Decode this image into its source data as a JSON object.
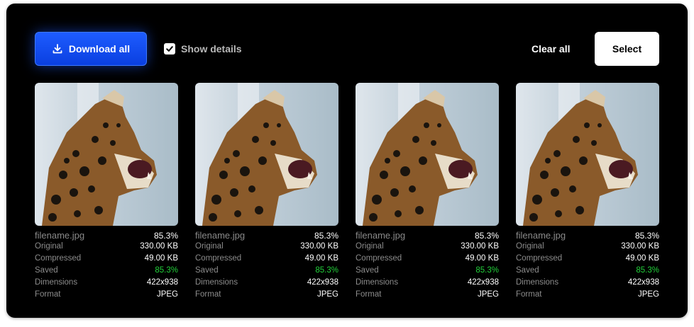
{
  "toolbar": {
    "download_label": "Download all",
    "show_details_label": "Show details",
    "show_details_checked": true,
    "clear_label": "Clear all",
    "select_label": "Select"
  },
  "labels": {
    "original": "Original",
    "compressed": "Compressed",
    "saved": "Saved",
    "dimensions": "Dimensions",
    "format": "Format"
  },
  "files": [
    {
      "filename": "filename.jpg",
      "percent": "85.3%",
      "original": "330.00 KB",
      "compressed": "49.00 KB",
      "saved": "85.3%",
      "dimensions": "422x938",
      "format": "JPEG"
    },
    {
      "filename": "filename.jpg",
      "percent": "85.3%",
      "original": "330.00 KB",
      "compressed": "49.00 KB",
      "saved": "85.3%",
      "dimensions": "422x938",
      "format": "JPEG"
    },
    {
      "filename": "filename.jpg",
      "percent": "85.3%",
      "original": "330.00 KB",
      "compressed": "49.00 KB",
      "saved": "85.3%",
      "dimensions": "422x938",
      "format": "JPEG"
    },
    {
      "filename": "filename.jpg",
      "percent": "85.3%",
      "original": "330.00 KB",
      "compressed": "49.00 KB",
      "saved": "85.3%",
      "dimensions": "422x938",
      "format": "JPEG"
    }
  ],
  "colors": {
    "accent": "#1e5cff",
    "saved_green": "#22d13a",
    "panel_bg": "#000000"
  },
  "icons": {
    "download": "download-icon",
    "check": "checkmark-icon"
  }
}
